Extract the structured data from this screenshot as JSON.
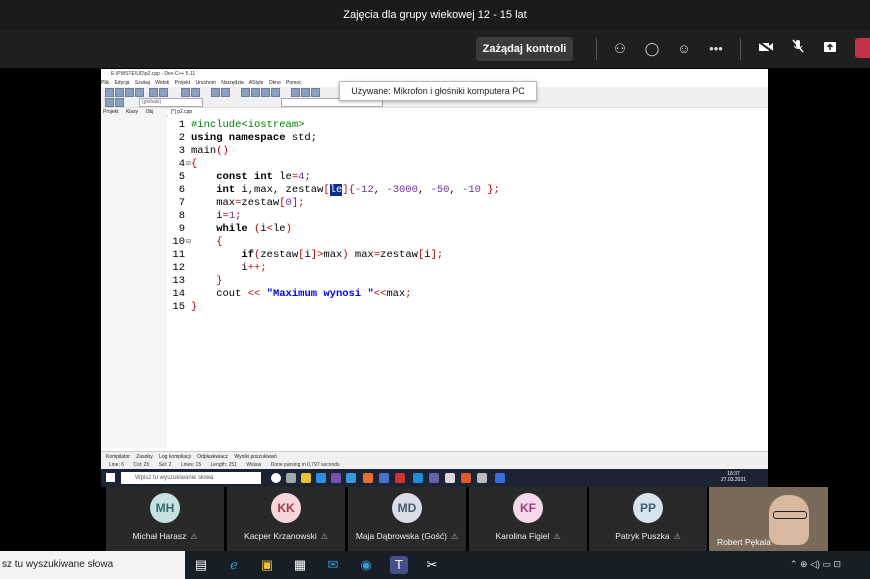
{
  "window": {
    "title": "Zajęcia dla grupy wiekowej 12 - 15 lat"
  },
  "toolbar": {
    "control_button": "Zażądaj kontroli",
    "icons": [
      "people-icon",
      "chat-icon",
      "reactions-icon",
      "more-icon",
      "camera-off-icon",
      "mic-off-icon",
      "share-icon",
      "leave-icon"
    ],
    "more_label": "•••",
    "leave_color": "#c4314b"
  },
  "devcpp": {
    "title": "E:\\PWSTE\\UD\\p2.cpp - Dev-C++ 5.11",
    "menu": [
      "Plik",
      "Edycja",
      "Szukaj",
      "Widok",
      "Projekt",
      "Uruchom",
      "Narzędzia",
      "AStyle",
      "Okno",
      "Pomoc"
    ],
    "globals": "(globals)",
    "tooltip": "Używane: Mikrofon i głośniki komputera PC",
    "panel_tabs": [
      "Projekt",
      "Klasy",
      "Obj"
    ],
    "file_tab": "[*] p2.cpp",
    "code_lines": [
      {
        "n": "1",
        "text": "#include<iostream>"
      },
      {
        "n": "2",
        "text": "using namespace std;"
      },
      {
        "n": "3",
        "text": "main()"
      },
      {
        "n": "4",
        "text": "{"
      },
      {
        "n": "5",
        "text": "    const int le=4;"
      },
      {
        "n": "6",
        "text": "    int i,max, zestaw[le]{-12, -3000, -50, -10 };"
      },
      {
        "n": "7",
        "text": "    max=zestaw[0];"
      },
      {
        "n": "8",
        "text": "    i=1;"
      },
      {
        "n": "9",
        "text": "    while (i<le)"
      },
      {
        "n": "10",
        "text": "    {"
      },
      {
        "n": "11",
        "text": "        if(zestaw[i]>max) max=zestaw[i];"
      },
      {
        "n": "12",
        "text": "        i++;"
      },
      {
        "n": "13",
        "text": "    }"
      },
      {
        "n": "14",
        "text": "    cout << \"Maximum wynosi \"<<max;"
      },
      {
        "n": "15",
        "text": "}"
      }
    ],
    "bottom_tabs": [
      "Kompilator",
      "Zasoby",
      "Log kompilacji",
      "Odpluskwiacz",
      "Wyniki poszukiwań"
    ],
    "status": {
      "line": "Line: 6",
      "col": "Col: 25",
      "sel": "Sel: 2",
      "lines": "Lines: 15",
      "length": "Length: 251",
      "mode": "Wstaw",
      "parse": "Done parsing in 0,797 seconds"
    },
    "inner_search": "Wpisz tu wyszukiwanie słowa",
    "inner_clock": {
      "time": "18:37",
      "date": "27.03.2021"
    }
  },
  "participants": [
    {
      "initials": "MH",
      "name": "Michał Harasz",
      "bg": "#c7e0e0",
      "fg": "#2f6f6f"
    },
    {
      "initials": "KK",
      "name": "Kacper Krzanowski",
      "bg": "#f6d6d8",
      "fg": "#a33a47"
    },
    {
      "initials": "MD",
      "name": "Maja Dąbrowska (Gość)",
      "bg": "#d9dde6",
      "fg": "#4a5675"
    },
    {
      "initials": "KF",
      "name": "Karolina Figiel",
      "bg": "#f3d9ea",
      "fg": "#9a3b7a"
    },
    {
      "initials": "PP",
      "name": "Patryk Puszka",
      "bg": "#d6e4ec",
      "fg": "#3b5f77"
    }
  ],
  "video_participant": {
    "name": "Robert Pękala"
  },
  "host_taskbar": {
    "search": "sz tu wyszukiwane słowa",
    "tray": "⌃ ⊕ ◁) ▭ ⊡"
  }
}
